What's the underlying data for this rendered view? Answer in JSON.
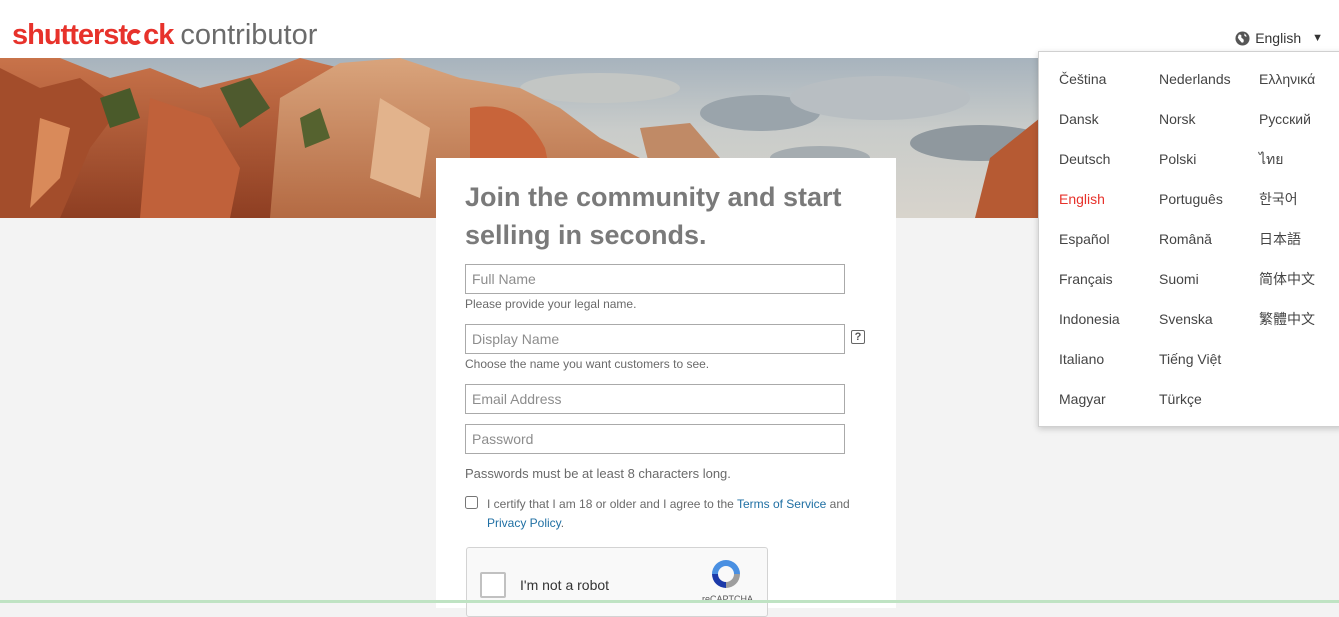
{
  "header": {
    "logo_brand_pre": "shutterst",
    "logo_brand_post": "ck",
    "logo_sub": "contributor",
    "language_label": "English",
    "caret": "▼"
  },
  "signup": {
    "title": "Join the community and start selling in seconds.",
    "full_name_placeholder": "Full Name",
    "full_name_hint": "Please provide your legal name.",
    "display_name_placeholder": "Display Name",
    "display_name_help": "?",
    "display_name_hint": "Choose the name you want customers to see.",
    "email_placeholder": "Email Address",
    "password_placeholder": "Password",
    "password_hint": "Passwords must be at least 8 characters long.",
    "certify_text": "I certify that I am 18 or older and I agree to the",
    "terms_link": "Terms of Service",
    "and_text": "and",
    "privacy_link": "Privacy Policy",
    "period": ".",
    "recaptcha_label": "I'm not a robot",
    "recaptcha_brand": "reCAPTCHA"
  },
  "language_menu": {
    "selected": "English",
    "columns": [
      [
        "Čeština",
        "Dansk",
        "Deutsch",
        "English",
        "Español",
        "Français",
        "Indonesia",
        "Italiano",
        "Magyar"
      ],
      [
        "Nederlands",
        "Norsk",
        "Polski",
        "Português",
        "Română",
        "Suomi",
        "Svenska",
        "Tiếng Việt",
        "Türkçe"
      ],
      [
        "Ελληνικά",
        "Русский",
        "ไทย",
        "한국어",
        "日本語",
        "简体中文",
        "繁體中文"
      ]
    ]
  },
  "colors": {
    "brand_red": "#e7322b",
    "link_blue": "#1f6fa3",
    "title_gray": "#7a7a7a"
  },
  "icons": [
    "globe-icon",
    "chevron-down-icon",
    "help-icon",
    "recaptcha-logo-icon"
  ]
}
